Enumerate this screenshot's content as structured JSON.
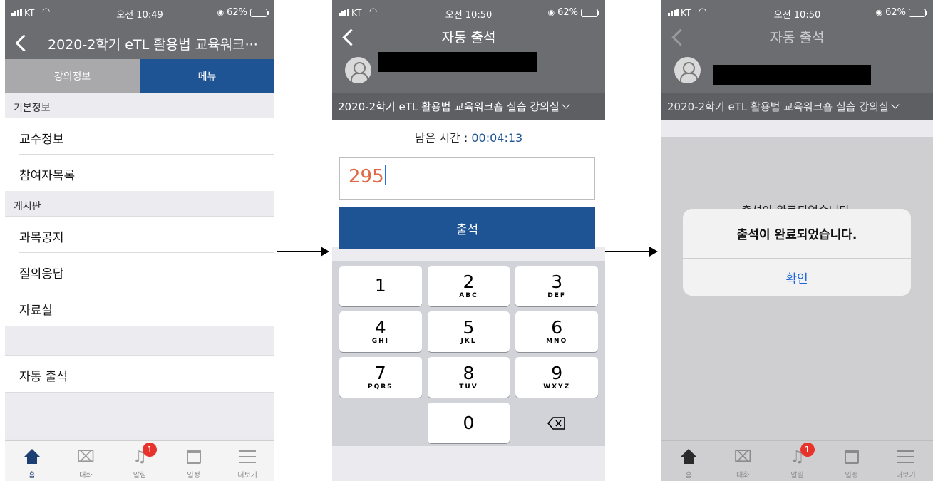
{
  "status": {
    "carrier": "KT",
    "battery": "62%",
    "time_p1": "오전 10:49",
    "time_p2": "오전 10:50",
    "time_p3": "오전 10:50",
    "battery_level": 0.62,
    "battery_color": "#ffd60a"
  },
  "colors": {
    "primary": "#1f5494",
    "header_gray": "#6b6d70",
    "badge_red": "#e8322c",
    "code_text": "#e06a47",
    "ios_blue": "#1e64d8"
  },
  "screen1": {
    "title": "2020-2학기 eTL 활용법 교육워크···",
    "tabs": {
      "info": "강의정보",
      "menu": "메뉴"
    },
    "sections": [
      {
        "header": "기본정보",
        "items": [
          "교수정보",
          "참여자목록"
        ]
      },
      {
        "header": "게시판",
        "items": [
          "과목공지",
          "질의응답",
          "자료실"
        ]
      }
    ],
    "auto_attendance": "자동 출석"
  },
  "screen2": {
    "title": "자동 출석",
    "course": "2020-2학기 eTL 활용법 교육워크숍 실습 강의실",
    "remaining_label": "남은 시간 : ",
    "remaining_value": "00:04:13",
    "code_value": "295",
    "submit_label": "출석",
    "keys": [
      {
        "num": "1",
        "letters": ""
      },
      {
        "num": "2",
        "letters": "ABC"
      },
      {
        "num": "3",
        "letters": "DEF"
      },
      {
        "num": "4",
        "letters": "GHI"
      },
      {
        "num": "5",
        "letters": "JKL"
      },
      {
        "num": "6",
        "letters": "MNO"
      },
      {
        "num": "7",
        "letters": "PQRS"
      },
      {
        "num": "8",
        "letters": "TUV"
      },
      {
        "num": "9",
        "letters": "WXYZ"
      },
      {
        "num": "0",
        "letters": ""
      }
    ]
  },
  "screen3": {
    "title": "자동 출석",
    "course": "2020-2학기 eTL 활용법 교육워크숍 실습 강의실",
    "behind_text": "출석이 완료되었습니다.",
    "alert_message": "출석이 완료되었습니다.",
    "alert_ok": "확인"
  },
  "tabbar": {
    "items": [
      {
        "label": "홈",
        "icon": "home-icon"
      },
      {
        "label": "대화",
        "icon": "chat-icon"
      },
      {
        "label": "알림",
        "icon": "bell-icon"
      },
      {
        "label": "일정",
        "icon": "calendar-icon"
      },
      {
        "label": "더보기",
        "icon": "more-icon"
      }
    ],
    "alert_badge": "1"
  }
}
